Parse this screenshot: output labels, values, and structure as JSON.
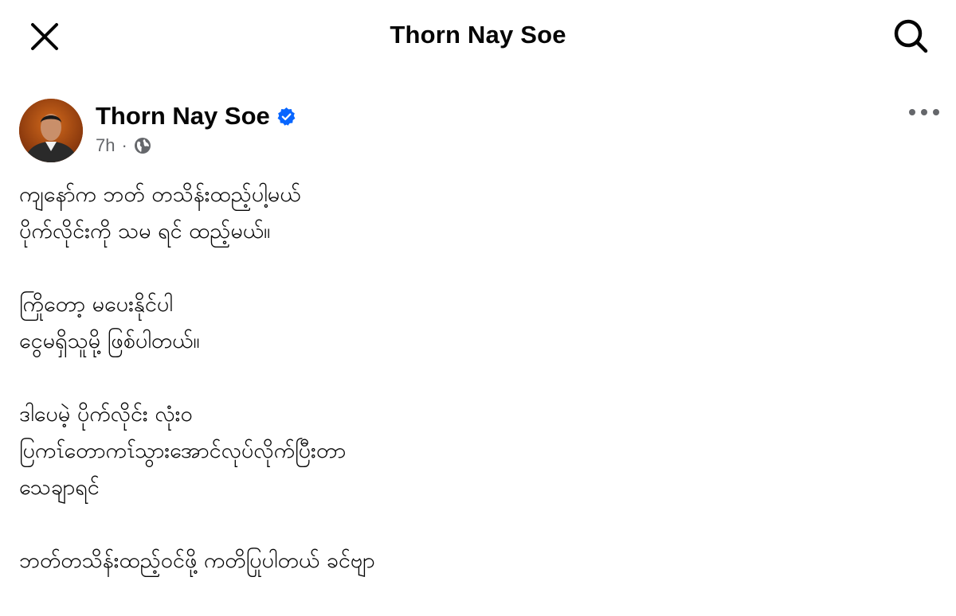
{
  "header": {
    "title": "Thorn Nay Soe",
    "close_icon": "close-icon",
    "search_icon": "search-icon"
  },
  "post": {
    "author": "Thorn Nay Soe",
    "verified_icon": "verified-badge-icon",
    "time": "7h",
    "separator": "·",
    "privacy_icon": "globe-icon",
    "more_icon": "more-options-icon",
    "paragraphs": [
      "ကျနော်က ဘတ် တသိန်းထည့်ပါ့မယ်\nပိုက်လိုင်းကို သမ ရင် ထည့်မယ်။",
      "ကြိုတော့ မပေးနိုင်ပါ\nငွေမရှိသူမို့ ဖြစ်ပါတယ်။",
      "ဒါပေမဲ့ ပိုက်လိုင်း လုံး၀\nပြကၤ်တောကၤ်သွားအောင်လုပ်လိုက်ပြီးတာ\nသေချာရင်",
      "ဘတ်တသိန်းထည့်ဝင်ဖို့ ကတိပြုပါတယ် ခင်ဗျာ"
    ]
  },
  "colors": {
    "text": "#050505",
    "secondary": "#65676b",
    "verified": "#0866ff"
  }
}
